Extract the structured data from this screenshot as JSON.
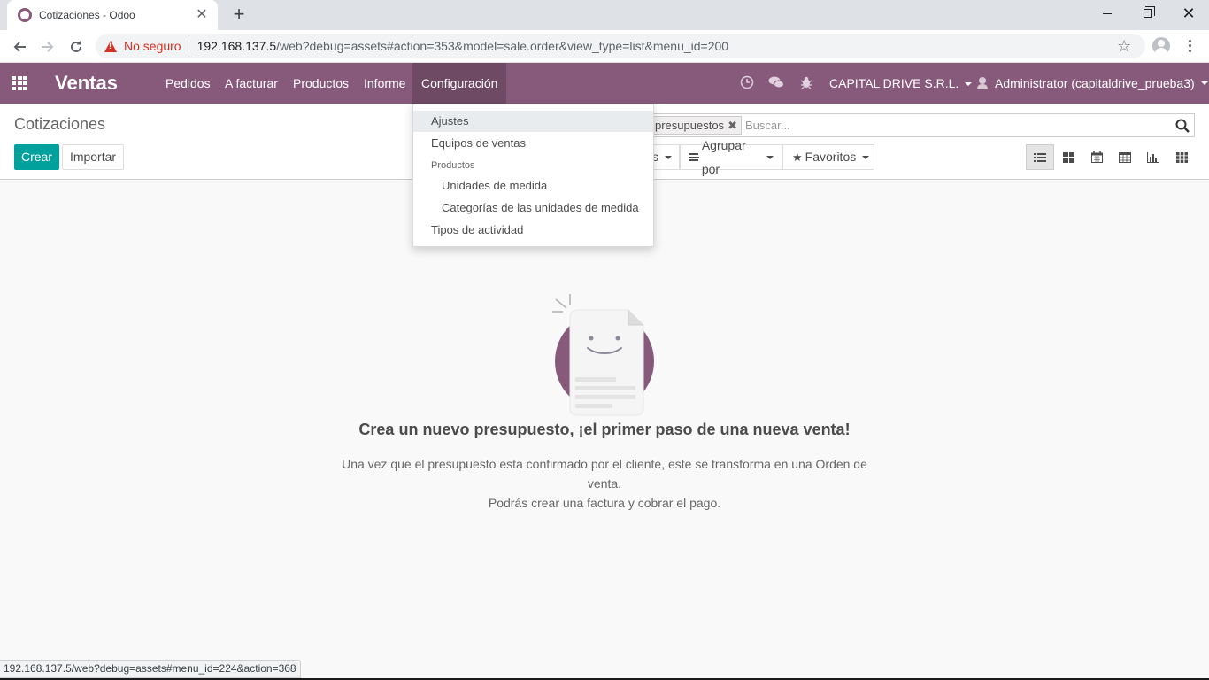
{
  "browser": {
    "tab_title": "Cotizaciones - Odoo",
    "tab_close": "✕",
    "new_tab": "+",
    "not_secure": "No seguro",
    "url_host": "192.168.137.5",
    "url_rest": "/web?debug=assets#action=353&model=sale.order&view_type=list&menu_id=200",
    "status_url": "192.168.137.5/web?debug=assets#menu_id=224&action=368"
  },
  "navbar": {
    "brand": "Ventas",
    "menu": [
      "Pedidos",
      "A facturar",
      "Productos",
      "Informe",
      "Configuración"
    ],
    "company": "CAPITAL DRIVE S.R.L.",
    "user": "Administrator (capitaldrive_prueba3)",
    "accent": "#875a7b"
  },
  "control_panel": {
    "breadcrumb": "Cotizaciones",
    "create_label": "Crear",
    "import_label": "Importar",
    "facet_label": "presupuestos",
    "search_placeholder": "Buscar...",
    "filters_partial": "s",
    "group_label": "Agrupar por",
    "favorites_label": "Favoritos",
    "create_color": "#00a09d"
  },
  "config_menu": {
    "items": [
      {
        "label": "Ajustes"
      },
      {
        "label": "Equipos de ventas"
      },
      {
        "label": "Productos"
      },
      {
        "label": "Unidades de medida"
      },
      {
        "label": "Categorías de las unidades de medida"
      },
      {
        "label": "Tipos de actividad"
      }
    ]
  },
  "empty_state": {
    "title": "Crea un nuevo presupuesto, ¡el primer paso de una nueva venta!",
    "line1": "Una vez que el presupuesto esta confirmado por el cliente, este se transforma en una Orden de venta.",
    "line2": "Podrás crear una factura y cobrar el pago."
  }
}
